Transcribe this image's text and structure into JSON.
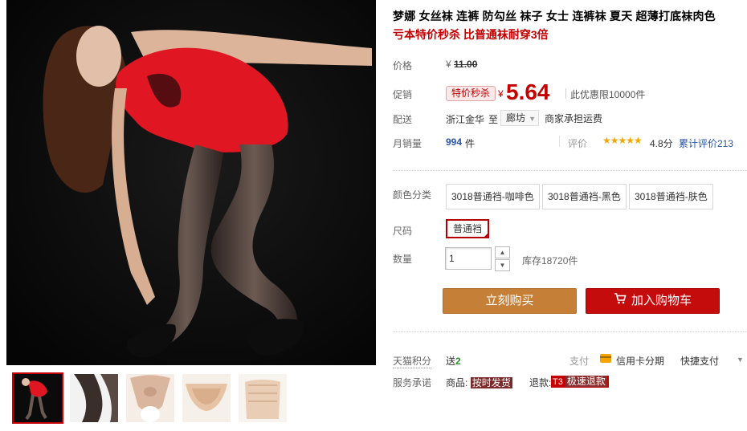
{
  "product": {
    "title": "梦娜 女丝袜 连裤 防勾丝 袜子 女士 连裤袜 夏天 超薄打底袜肉色",
    "subtitle": "亏本特价秒杀 比普通袜耐穿3倍"
  },
  "price": {
    "label": "价格",
    "currency": "¥",
    "original": "11.00"
  },
  "promo": {
    "label": "促销",
    "badge": "特价秒杀",
    "currency": "¥",
    "price": "5.64",
    "limit": "此优惠限10000件"
  },
  "shipping": {
    "label": "配送",
    "from": "浙江金华",
    "to_word": "至",
    "region": "廊坊",
    "fee": "商家承担运费"
  },
  "sales": {
    "label": "月销量",
    "count": "994",
    "unit": "件",
    "rating_label": "评价",
    "stars": 5,
    "stars_text": "★★★★★",
    "score": "4.8分",
    "review_link": "累计评价213"
  },
  "options": {
    "color_label": "颜色分类",
    "colors": [
      "3018普通裆-咖啡色",
      "3018普通裆-黑色",
      "3018普通裆-肤色"
    ],
    "size_label": "尺码",
    "size_selected": "普通裆",
    "qty_label": "数量",
    "qty_value": "1",
    "qty_up": "▲",
    "qty_down": "▼",
    "stock": "库存18720件"
  },
  "actions": {
    "buy_now": "立刻购买",
    "add_to_cart": "加入购物车",
    "cart_icon": "shopping-cart-icon"
  },
  "extras": {
    "points_label": "天猫积分",
    "points_prefix": "送",
    "points_value": "2",
    "pay_label": "支付",
    "credit": "信用卡分期",
    "quickpay": "快捷支付",
    "service_label": "服务承诺",
    "goods_label": "商品:",
    "goods_tag": "按时发货",
    "refund_label": "退款:",
    "refund_badge": "T3",
    "refund_tag": "极速退款"
  },
  "colors": {
    "accent_red": "#c40000",
    "buy_orange": "#c57f36",
    "cart_red": "#c50c0c",
    "link_blue": "#2953a6",
    "star_gold": "#f0a800"
  }
}
